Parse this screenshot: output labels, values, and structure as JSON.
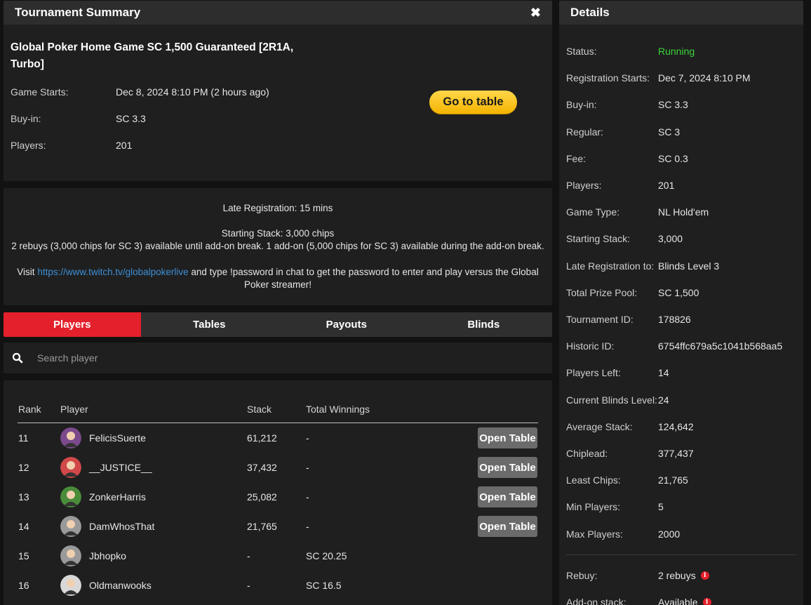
{
  "summary": {
    "title": "Tournament Summary",
    "close_label": "✖",
    "tournament_name": "Global Poker Home Game SC 1,500 Guaranteed [2R1A, Turbo]",
    "game_starts_label": "Game Starts:",
    "game_starts_value": "Dec 8, 2024 8:10 PM (2 hours ago)",
    "buyin_label": "Buy-in:",
    "buyin_value": "SC 3.3",
    "players_label": "Players:",
    "players_value": "201",
    "go_button": "Go to table"
  },
  "info": {
    "late_reg": "Late Registration: 15 mins",
    "starting_stack": "Starting Stack: 3,000 chips",
    "rebuys": "2 rebuys (3,000 chips for SC 3) available until add-on break. 1 add-on (5,000 chips for SC 3) available during the add-on break.",
    "visit_prefix": "Visit ",
    "visit_link": "https://www.twitch.tv/globalpokerlive",
    "visit_suffix": " and type !password in chat to get the password to enter and play versus the Global",
    "visit_line2": "Poker streamer!"
  },
  "tabs": [
    "Players",
    "Tables",
    "Payouts",
    "Blinds"
  ],
  "search": {
    "placeholder": "Search player"
  },
  "players_table": {
    "headers": {
      "rank": "Rank",
      "player": "Player",
      "stack": "Stack",
      "winnings": "Total Winnings"
    },
    "open_label": "Open Table",
    "rows": [
      {
        "rank": "11",
        "name": "FelicisSuerte",
        "stack": "61,212",
        "winnings": "-",
        "avatar_color": "#7a4a8c"
      },
      {
        "rank": "12",
        "name": "__JUSTICE__",
        "stack": "37,432",
        "winnings": "-",
        "avatar_color": "#d04848"
      },
      {
        "rank": "13",
        "name": "ZonkerHarris",
        "stack": "25,082",
        "winnings": "-",
        "avatar_color": "#4a8c3a"
      },
      {
        "rank": "14",
        "name": "DamWhosThat",
        "stack": "21,765",
        "winnings": "-",
        "avatar_color": "#9a9a9a"
      },
      {
        "rank": "15",
        "name": "Jbhopko",
        "stack": "-",
        "winnings": "SC 20.25",
        "avatar_color": "#9a9a9a"
      },
      {
        "rank": "16",
        "name": "Oldmanwooks",
        "stack": "-",
        "winnings": "SC 16.5",
        "avatar_color": "#d8d8d8"
      }
    ]
  },
  "details": {
    "title": "Details",
    "status_color": "#3bd43b",
    "rows": [
      {
        "label": "Status:",
        "value": "Running"
      },
      {
        "label": "Registration Starts:",
        "value": "Dec 7, 2024 8:10 PM"
      },
      {
        "label": "Buy-in:",
        "value": "SC 3.3"
      },
      {
        "label": "Regular:",
        "value": "SC 3"
      },
      {
        "label": "Fee:",
        "value": "SC 0.3"
      },
      {
        "label": "Players:",
        "value": "201"
      },
      {
        "label": "Game Type:",
        "value": "NL Hold'em"
      },
      {
        "label": "Starting Stack:",
        "value": "3,000"
      },
      {
        "label": "Late Registration to:",
        "value": "Blinds Level 3"
      },
      {
        "label": "Total Prize Pool:",
        "value": "SC 1,500"
      },
      {
        "label": "Tournament ID:",
        "value": "178826"
      },
      {
        "label": "Historic ID:",
        "value": "6754ffc679a5c1041b568aa5"
      },
      {
        "label": "Players Left:",
        "value": "14"
      },
      {
        "label": "Current Blinds Level:",
        "value": "24"
      },
      {
        "label": "Average Stack:",
        "value": "124,642"
      },
      {
        "label": "Chiplead:",
        "value": "377,437"
      },
      {
        "label": "Least Chips:",
        "value": "21,765"
      },
      {
        "label": "Min Players:",
        "value": "5"
      },
      {
        "label": "Max Players:",
        "value": "2000"
      }
    ],
    "rebuy_label": "Rebuy:",
    "rebuy_value": "2 rebuys",
    "addon_label": "Add-on stack:",
    "addon_value": "Available"
  }
}
